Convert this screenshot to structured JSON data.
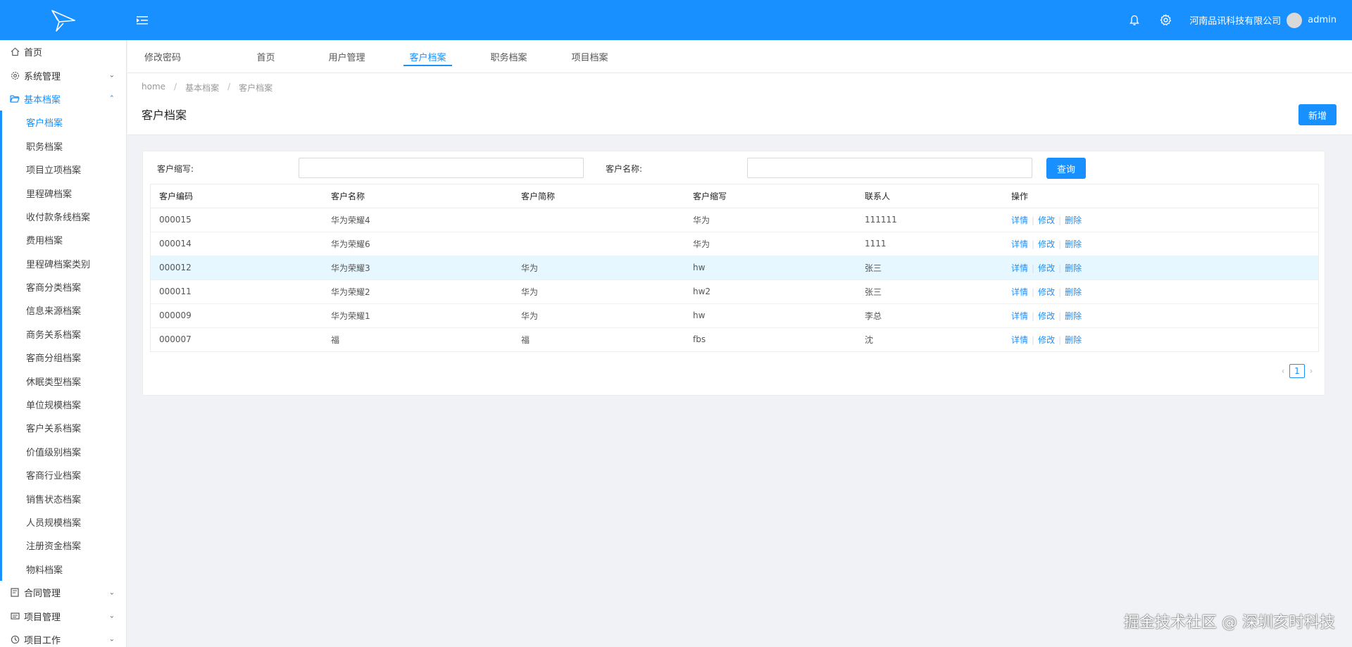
{
  "header": {
    "company": "河南品讯科技有限公司",
    "username": "admin"
  },
  "sidebar": {
    "top_items": [
      {
        "label": "首页"
      },
      {
        "label": "系统管理"
      },
      {
        "label": "基本档案"
      }
    ],
    "sub_items": [
      {
        "label": "客户档案"
      },
      {
        "label": "职务档案"
      },
      {
        "label": "项目立项档案"
      },
      {
        "label": "里程碑档案"
      },
      {
        "label": "收付款条线档案"
      },
      {
        "label": "费用档案"
      },
      {
        "label": "里程碑档案类别"
      },
      {
        "label": "客商分类档案"
      },
      {
        "label": "信息来源档案"
      },
      {
        "label": "商务关系档案"
      },
      {
        "label": "客商分组档案"
      },
      {
        "label": "休眠类型档案"
      },
      {
        "label": "单位规模档案"
      },
      {
        "label": "客户关系档案"
      },
      {
        "label": "价值级别档案"
      },
      {
        "label": "客商行业档案"
      },
      {
        "label": "销售状态档案"
      },
      {
        "label": "人员规模档案"
      },
      {
        "label": "注册资金档案"
      },
      {
        "label": "物料档案"
      }
    ],
    "bottom_items": [
      {
        "label": "合同管理"
      },
      {
        "label": "项目管理"
      },
      {
        "label": "项目工作"
      }
    ]
  },
  "tabs": [
    {
      "label": "修改密码"
    },
    {
      "label": "首页"
    },
    {
      "label": "用户管理"
    },
    {
      "label": "客户档案"
    },
    {
      "label": "职务档案"
    },
    {
      "label": "项目档案"
    }
  ],
  "breadcrumb": [
    "home",
    "基本档案",
    "客户档案"
  ],
  "page": {
    "title": "客户档案",
    "new_label": "新增"
  },
  "search": {
    "abbr_label": "客户缩写:",
    "abbr_value": "",
    "name_label": "客户名称:",
    "name_value": "",
    "query_label": "查询"
  },
  "table": {
    "headers": [
      "客户编码",
      "客户名称",
      "客户简称",
      "客户缩写",
      "联系人",
      "操作"
    ],
    "actions": [
      "详情",
      "修改",
      "删除"
    ],
    "rows": [
      {
        "code": "000015",
        "name": "华为荣耀4",
        "short": "",
        "abbr": "华为",
        "contact": "111111"
      },
      {
        "code": "000014",
        "name": "华为荣耀6",
        "short": "",
        "abbr": "华为",
        "contact": "1111"
      },
      {
        "code": "000012",
        "name": "华为荣耀3",
        "short": "华为",
        "abbr": "hw",
        "contact": "张三"
      },
      {
        "code": "000011",
        "name": "华为荣耀2",
        "short": "华为",
        "abbr": "hw2",
        "contact": "张三"
      },
      {
        "code": "000009",
        "name": "华为荣耀1",
        "short": "华为",
        "abbr": "hw",
        "contact": "李总"
      },
      {
        "code": "000007",
        "name": "福",
        "short": "福",
        "abbr": "fbs",
        "contact": "沈"
      }
    ]
  },
  "pagination": {
    "current": "1",
    "prev": "‹",
    "next": "›"
  },
  "watermark": "掘金技术社区 @ 深圳亥时科技",
  "colors": {
    "primary": "#1890ff",
    "row_highlight": "#e6f7ff"
  }
}
